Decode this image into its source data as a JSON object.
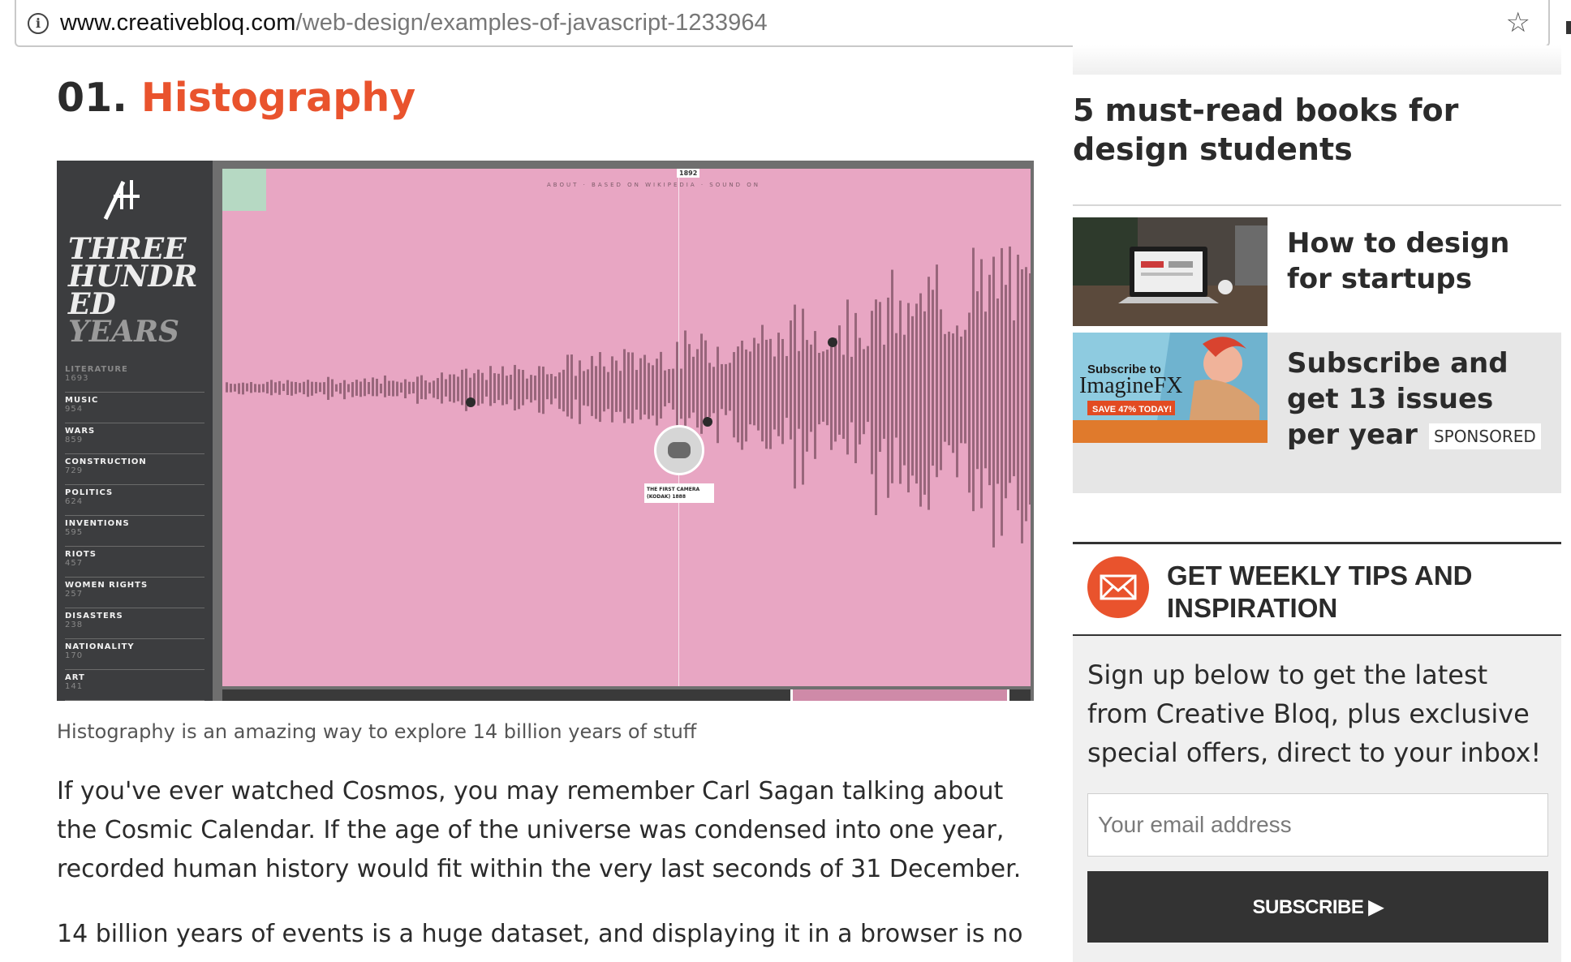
{
  "browser": {
    "url_host": "www.creativebloq.com",
    "url_path": "/web-design/examples-of-javascript-1233964",
    "info_icon": "info-icon",
    "bookmark_icon": "star-icon"
  },
  "article": {
    "number": "01.",
    "title": "Histography",
    "hero": {
      "brand_line1": "THREE",
      "brand_line2": "HUNDR",
      "brand_line3": "ED",
      "brand_line4": "YEARS",
      "nav": "ABOUT · BASED ON WIKIPEDIA · SOUND ON",
      "year": "1892",
      "event_label": "THE FIRST CAMERA (KODAK) 1888",
      "categories": [
        {
          "name": "LITERATURE",
          "value": "1693"
        },
        {
          "name": "MUSIC",
          "value": "954"
        },
        {
          "name": "WARS",
          "value": "859"
        },
        {
          "name": "CONSTRUCTION",
          "value": "729"
        },
        {
          "name": "POLITICS",
          "value": "624"
        },
        {
          "name": "INVENTIONS",
          "value": "595"
        },
        {
          "name": "RIOTS",
          "value": "457"
        },
        {
          "name": "WOMEN RIGHTS",
          "value": "257"
        },
        {
          "name": "DISASTERS",
          "value": "238"
        },
        {
          "name": "NATIONALITY",
          "value": "170"
        },
        {
          "name": "ART",
          "value": "141"
        }
      ]
    },
    "caption": "Histography is an amazing way to explore 14 billion years of stuff",
    "paragraph1": "If you've ever watched Cosmos, you may remember Carl Sagan talking about the Cosmic Calendar. If the age of the universe was condensed into one year, recorded human history would fit within the very last seconds of 31 December.",
    "paragraph2": "14 billion years of events is a huge dataset, and displaying it in a browser is no"
  },
  "sidebar": {
    "heading": "5 must-read books for design students",
    "promos": [
      {
        "title": "How to design for startups"
      },
      {
        "title": "Subscribe and get 13 issues per year",
        "badge": "SPONSORED",
        "image_text_top": "Subscribe to",
        "image_brand": "ImagineFX",
        "image_offer": "SAVE 47% TODAY!"
      }
    ],
    "newsletter": {
      "title": "GET WEEKLY TIPS AND INSPIRATION",
      "description": "Sign up below to get the latest from Creative Bloq, plus exclusive special offers, direct to your inbox!",
      "email_placeholder": "Your email address",
      "button_label": "SUBSCRIBE ▶"
    }
  },
  "colors": {
    "accent": "#e9532d",
    "hero_pink": "#e8a6c3",
    "dark_button": "#333333"
  }
}
